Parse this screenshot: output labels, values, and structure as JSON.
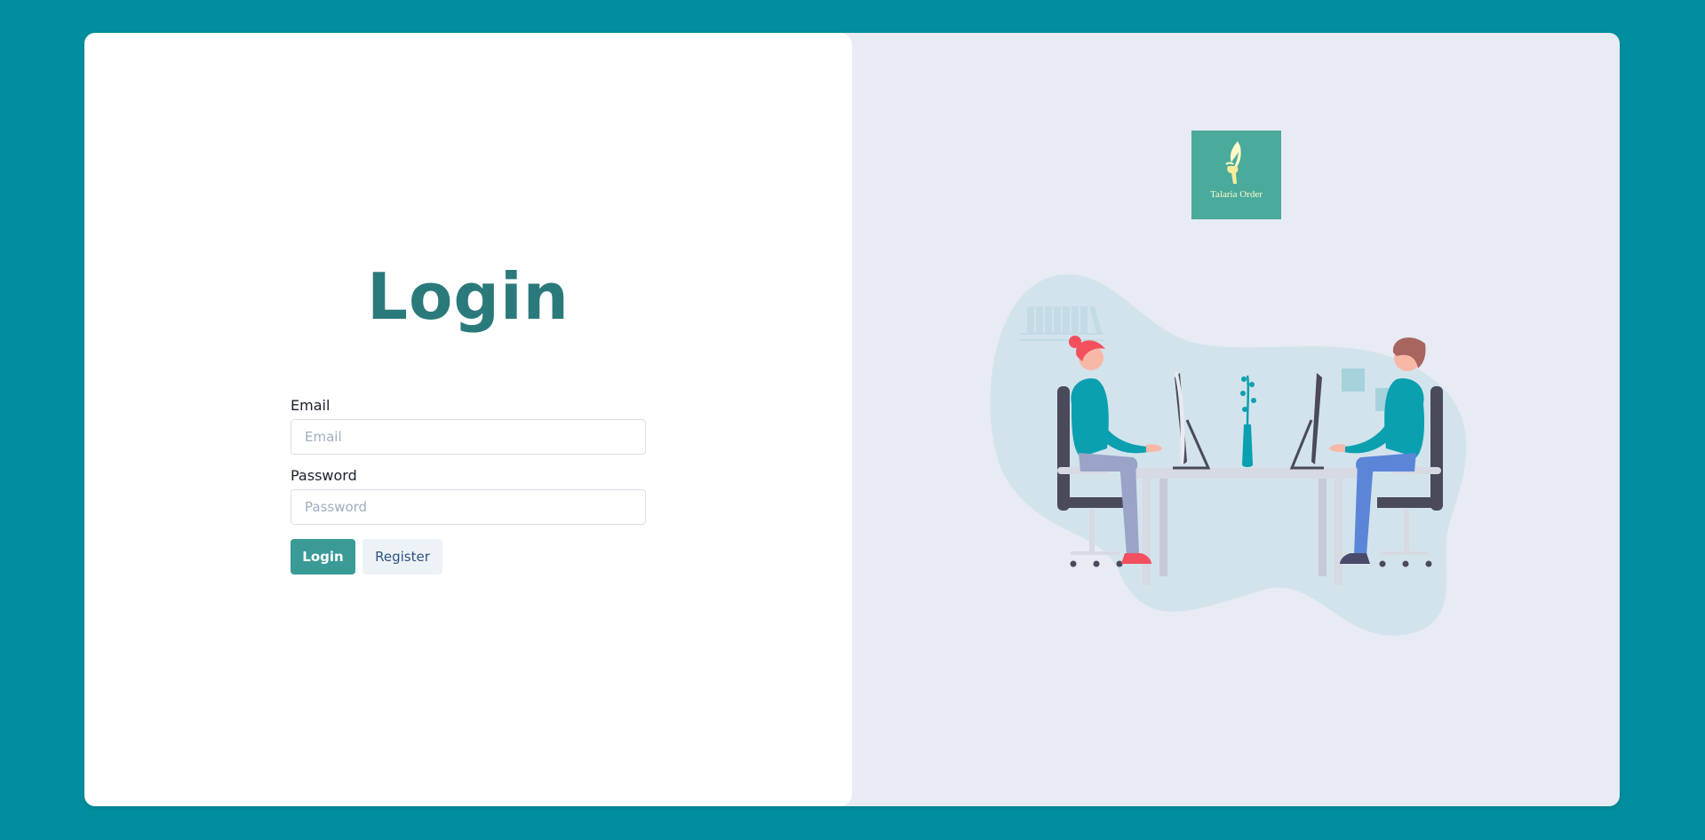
{
  "login": {
    "title": "Login",
    "email_label": "Email",
    "email_placeholder": "Email",
    "email_value": "",
    "password_label": "Password",
    "password_placeholder": "Password",
    "password_value": "",
    "login_button": "Login",
    "register_button": "Register"
  },
  "logo": {
    "text": "Talaria Order"
  },
  "colors": {
    "page_background": "#018f9f",
    "title": "#2b7a7b",
    "login_button": "#399a96",
    "register_button_text": "#2c5282",
    "logo_background": "#4aaa9c",
    "right_panel": "#e8ebf4"
  },
  "icons": {
    "logo_mark": "winged-sandal-icon",
    "illustration": "office-workers-illustration"
  }
}
